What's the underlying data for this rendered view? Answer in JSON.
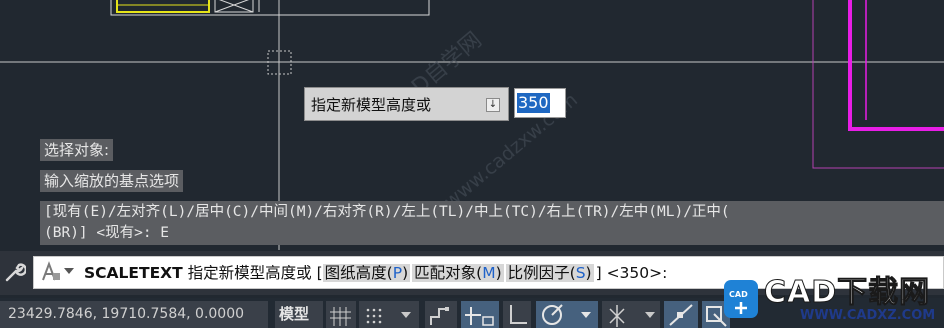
{
  "prompt": {
    "label": "指定新模型高度或",
    "arrow_icon": "down-arrow-key-icon",
    "value": "350"
  },
  "history": {
    "line1": "选择对象:",
    "line2": "输入缩放的基点选项",
    "line3a": "[现有(E)/左对齐(L)/居中(C)/中间(M)/右对齐(R)/左上(TL)/中上(TC)/右上(TR)/左中(ML)/正中(",
    "line3b": "(BR)] <现有>: E"
  },
  "command": {
    "name": "SCALETEXT",
    "prompt": "指定新模型高度或",
    "bracket_open": "[",
    "options": [
      {
        "label": "图纸高度(",
        "key": "P",
        "close": ")"
      },
      {
        "label": "匹配对象(",
        "key": "M",
        "close": ")"
      },
      {
        "label": "比例因子(",
        "key": "S",
        "close": ")"
      }
    ],
    "tail": "] <350>:",
    "icon": "autocad-command-icon"
  },
  "status": {
    "coordinates": "23429.7846, 19710.7584, 0.0000",
    "model_label": "模型"
  },
  "watermark": {
    "line1": "CAD自学网",
    "line2": "www.cadzxw.com"
  },
  "brand": {
    "title": "CAD下载网",
    "url": "WWW.CADXZ.COM"
  },
  "colors": {
    "canvas_bg": "#212830",
    "magenta": "#e81ee6",
    "yellow": "#e7e51a",
    "selection": "#1f68c2",
    "option_key": "#1f62c9"
  }
}
